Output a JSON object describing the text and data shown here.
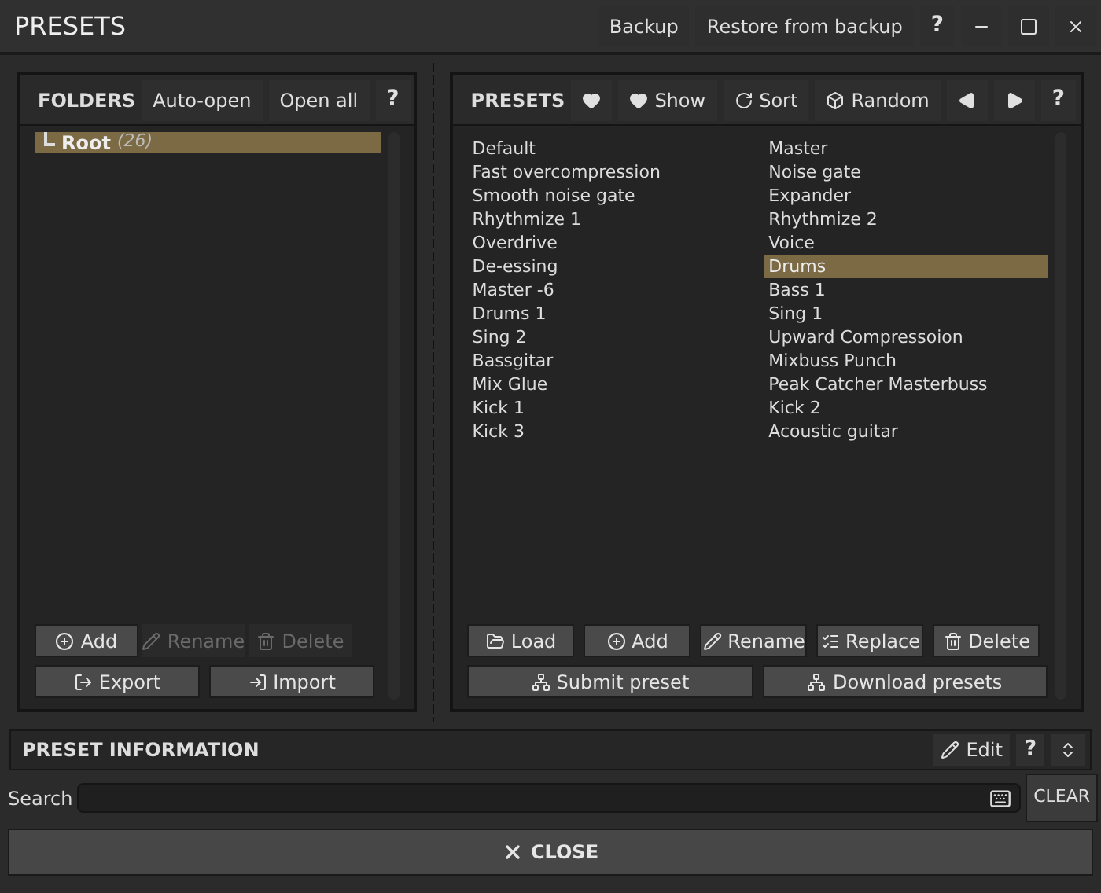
{
  "window": {
    "title": "PRESETS",
    "buttons": [
      {
        "kind": "text",
        "label": "Backup"
      },
      {
        "kind": "text",
        "label": "Restore from backup"
      },
      {
        "kind": "help",
        "label": "?"
      },
      {
        "kind": "minimize"
      },
      {
        "kind": "maximize"
      },
      {
        "kind": "close"
      }
    ]
  },
  "folders": {
    "title": "FOLDERS",
    "header_buttons": [
      {
        "kind": "text",
        "label": "Auto-open"
      },
      {
        "kind": "text",
        "label": "Open all"
      },
      {
        "kind": "help",
        "label": "?"
      }
    ],
    "tree": [
      {
        "name": "Root",
        "count": "(26)",
        "selected": true
      }
    ],
    "buttons": [
      {
        "kind": "add",
        "label": "Add",
        "disabled": false
      },
      {
        "kind": "rename",
        "label": "Rename",
        "disabled": true
      },
      {
        "kind": "delete",
        "label": "Delete",
        "disabled": true
      },
      {
        "kind": "export",
        "label": "Export",
        "disabled": false
      },
      {
        "kind": "import",
        "label": "Import",
        "disabled": false
      }
    ]
  },
  "presets": {
    "title": "PRESETS",
    "header_buttons": [
      {
        "kind": "heart"
      },
      {
        "kind": "heart",
        "label": "Show"
      },
      {
        "kind": "sort",
        "label": "Sort"
      },
      {
        "kind": "random",
        "label": "Random"
      },
      {
        "kind": "prev"
      },
      {
        "kind": "next"
      },
      {
        "kind": "help",
        "label": "?"
      }
    ],
    "items": [
      {
        "name": "Default",
        "selected": false
      },
      {
        "name": "Fast overcompression",
        "selected": false
      },
      {
        "name": "Smooth noise gate",
        "selected": false
      },
      {
        "name": "Rhythmize 1",
        "selected": false
      },
      {
        "name": "Overdrive",
        "selected": false
      },
      {
        "name": "De-essing",
        "selected": false
      },
      {
        "name": "Master -6",
        "selected": false
      },
      {
        "name": "Drums 1",
        "selected": false
      },
      {
        "name": "Sing 2",
        "selected": false
      },
      {
        "name": "Bassgitar",
        "selected": false
      },
      {
        "name": "Mix Glue",
        "selected": false
      },
      {
        "name": "Kick 1",
        "selected": false
      },
      {
        "name": "Kick 3",
        "selected": false
      },
      {
        "name": "Master",
        "selected": false
      },
      {
        "name": "Noise gate",
        "selected": false
      },
      {
        "name": "Expander",
        "selected": false
      },
      {
        "name": "Rhythmize 2",
        "selected": false
      },
      {
        "name": "Voice",
        "selected": false
      },
      {
        "name": "Drums",
        "selected": true
      },
      {
        "name": "Bass 1",
        "selected": false
      },
      {
        "name": "Sing 1",
        "selected": false
      },
      {
        "name": "Upward Compressoion",
        "selected": false
      },
      {
        "name": "Mixbuss Punch",
        "selected": false
      },
      {
        "name": "Peak Catcher Masterbuss",
        "selected": false
      },
      {
        "name": "Kick 2",
        "selected": false
      },
      {
        "name": "Acoustic guitar",
        "selected": false
      }
    ],
    "buttons": [
      {
        "kind": "load",
        "label": "Load"
      },
      {
        "kind": "add",
        "label": "Add"
      },
      {
        "kind": "rename",
        "label": "Rename"
      },
      {
        "kind": "replace",
        "label": "Replace"
      },
      {
        "kind": "delete",
        "label": "Delete"
      }
    ],
    "wide_buttons": [
      {
        "kind": "network",
        "label": "Submit preset"
      },
      {
        "kind": "network",
        "label": "Download presets"
      }
    ]
  },
  "preset_information": {
    "title": "PRESET INFORMATION",
    "buttons": [
      {
        "kind": "edit",
        "label": "Edit"
      },
      {
        "kind": "help",
        "label": "?"
      },
      {
        "kind": "expand"
      }
    ]
  },
  "search": {
    "label": "Search",
    "clear": "CLEAR"
  },
  "close_button": "CLOSE"
}
